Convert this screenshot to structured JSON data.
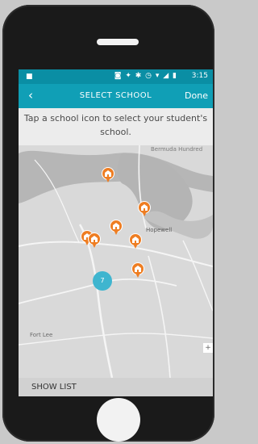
{
  "status_bar": {
    "time": "3:15"
  },
  "header": {
    "back_icon": "chevron-left-icon",
    "title": "SELECT SCHOOL",
    "done_label": "Done"
  },
  "instructions": "Tap a school icon to select your student's school.",
  "map": {
    "labels": {
      "bermuda_hundred": "Bermuda Hundred",
      "hopewell": "Hopewell",
      "fort_lee": "Fort Lee"
    },
    "cluster_count": "7",
    "zoom_button": "+"
  },
  "footer": {
    "show_list_label": "SHOW LIST"
  },
  "colors": {
    "accent": "#109fb6",
    "status_bar": "#0a8ea4",
    "pin": "#ee7d22",
    "cluster": "#3fb5cf"
  }
}
